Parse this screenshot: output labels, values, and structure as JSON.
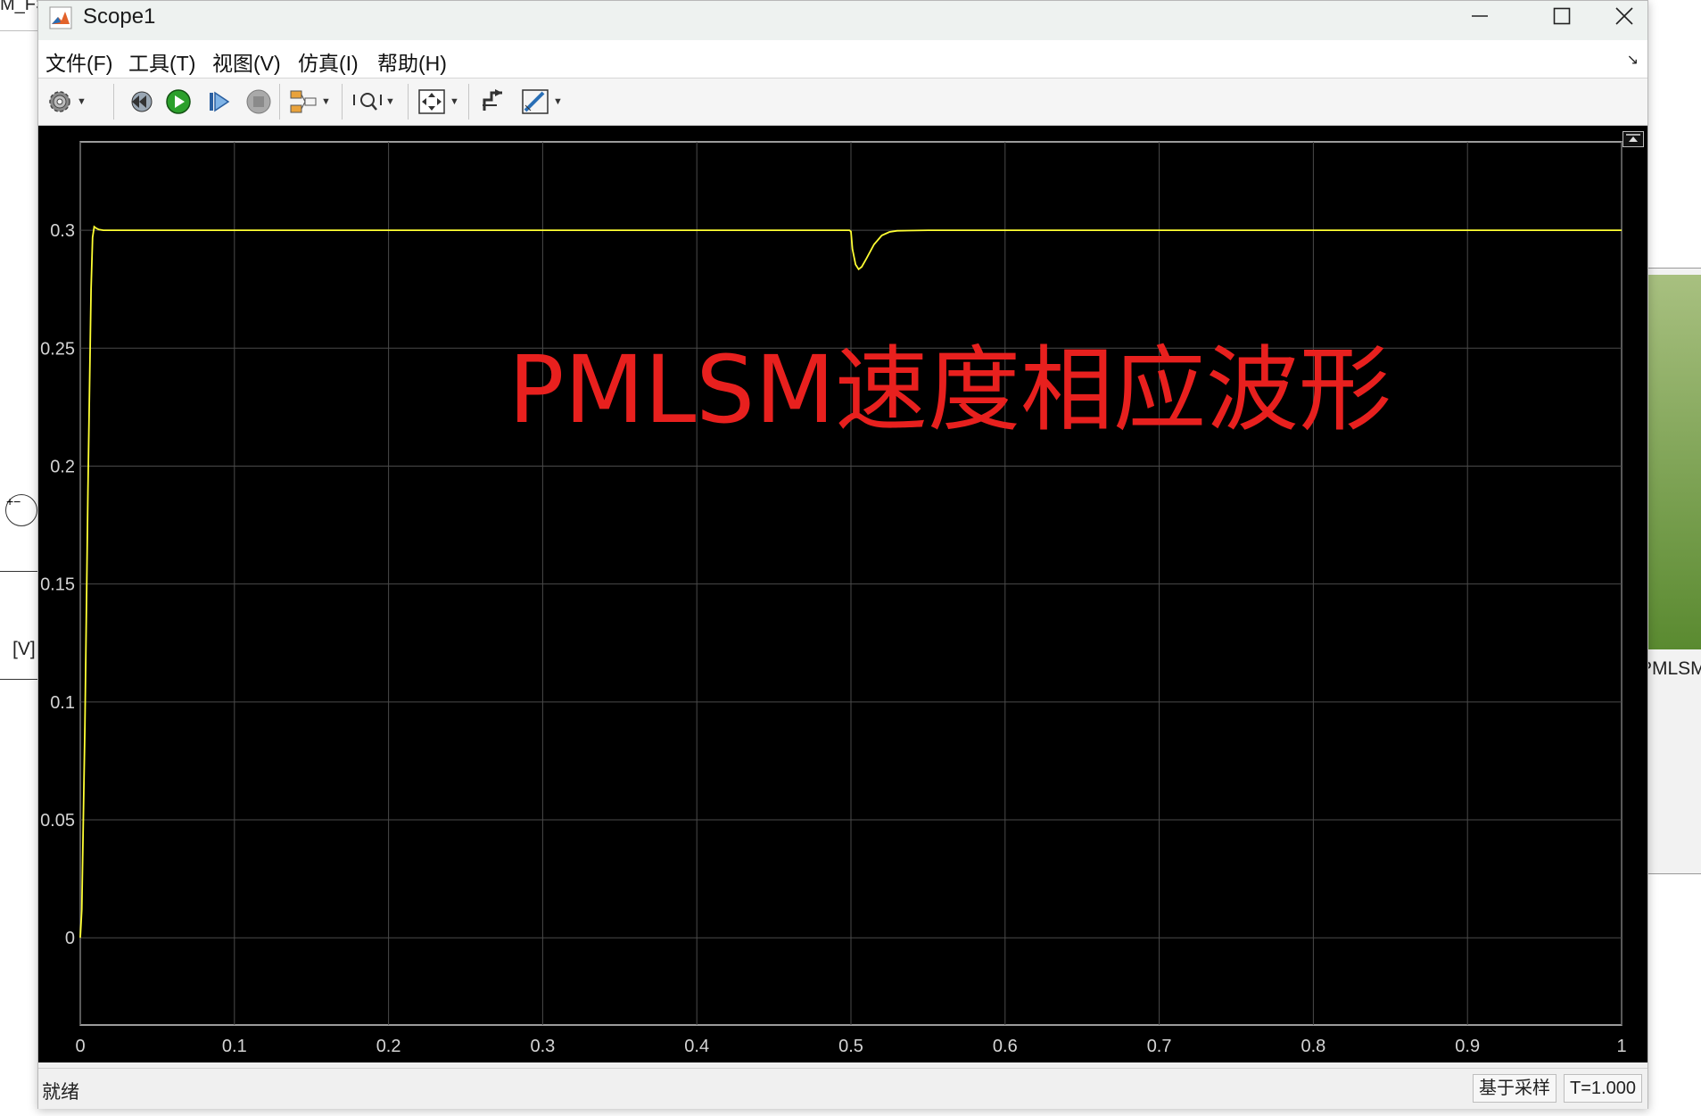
{
  "background": {
    "title_fragment": "M_FS",
    "left_block_label": "[V]",
    "right_block_label": "PMLSM",
    "sum_signs": "+−"
  },
  "window": {
    "title": "Scope1",
    "app_icon": "matlab-icon",
    "controls": {
      "minimize": "minimize-icon",
      "maximize": "maximize-icon",
      "close": "close-icon"
    }
  },
  "menu": {
    "items": [
      "文件(F)",
      "工具(T)",
      "视图(V)",
      "仿真(I)",
      "帮助(H)"
    ],
    "right_arrow": "↘"
  },
  "toolbar": {
    "buttons": [
      {
        "name": "settings-icon",
        "dropdown": true
      },
      {
        "name": "step-back-icon",
        "dropdown": false
      },
      {
        "name": "run-icon",
        "dropdown": false
      },
      {
        "name": "step-forward-icon",
        "dropdown": false
      },
      {
        "name": "stop-icon",
        "dropdown": false
      },
      {
        "name": "signal-selector-icon",
        "dropdown": true
      },
      {
        "name": "zoom-icon",
        "dropdown": true
      },
      {
        "name": "fit-to-view-icon",
        "dropdown": false
      },
      {
        "name": "triggers-icon",
        "dropdown": true
      },
      {
        "name": "cursor-measurements-icon",
        "dropdown": false
      },
      {
        "name": "measurement-tools-icon",
        "dropdown": true
      }
    ]
  },
  "chart_data": {
    "type": "line",
    "title": "",
    "xlabel": "",
    "ylabel": "",
    "xlim": [
      0,
      1
    ],
    "ylim": [
      -0.037,
      0.3375
    ],
    "x_ticks": [
      "0",
      "0.1",
      "0.2",
      "0.3",
      "0.4",
      "0.5",
      "0.6",
      "0.7",
      "0.8",
      "0.9",
      "1"
    ],
    "y_ticks": [
      "0",
      "0.05",
      "0.1",
      "0.15",
      "0.2",
      "0.25",
      "0.3"
    ],
    "grid": true,
    "background_color": "#000000",
    "grid_color": "#4a4a4a",
    "annotation": "PMLSM速度相应波形",
    "annotation_color": "#e8201e",
    "series": [
      {
        "color": "#ffff33",
        "x": [
          0,
          0.001,
          0.003,
          0.005,
          0.007,
          0.008,
          0.009,
          0.01,
          0.012,
          0.015,
          0.02,
          0.1,
          0.2,
          0.3,
          0.4,
          0.499,
          0.5,
          0.501,
          0.503,
          0.505,
          0.507,
          0.51,
          0.515,
          0.52,
          0.525,
          0.53,
          0.55,
          0.6,
          0.7,
          0.8,
          0.9,
          1
        ],
        "y": [
          0,
          0.012,
          0.09,
          0.19,
          0.275,
          0.297,
          0.3015,
          0.301,
          0.3003,
          0.3,
          0.3,
          0.3,
          0.3,
          0.3,
          0.3,
          0.3,
          0.2995,
          0.292,
          0.2855,
          0.2835,
          0.2845,
          0.288,
          0.294,
          0.2978,
          0.2993,
          0.2998,
          0.3,
          0.3,
          0.3,
          0.3,
          0.3,
          0.3
        ]
      }
    ]
  },
  "status": {
    "left": "就绪",
    "sample_mode": "基于采样",
    "time": "T=1.000"
  }
}
